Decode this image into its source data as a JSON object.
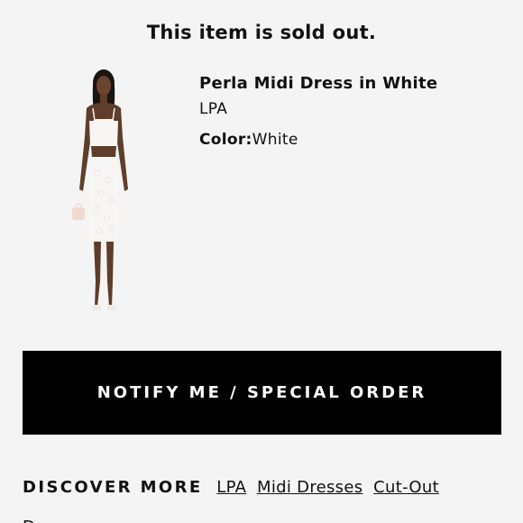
{
  "header": {
    "title": "This item is sold out."
  },
  "product": {
    "name": "Perla Midi Dress in White",
    "brand": "LPA",
    "color_label": "Color:",
    "color_value": "White",
    "image_icon": "dress-photo"
  },
  "actions": {
    "notify_label": "NOTIFY ME / SPECIAL ORDER"
  },
  "discover": {
    "title": "DISCOVER MORE",
    "links": [
      "LPA",
      "Midi Dresses",
      "Cut-Out Dresses"
    ]
  },
  "colors": {
    "background": "#f4f4f4",
    "button": "#000000",
    "button_text": "#ffffff",
    "text": "#111111"
  }
}
